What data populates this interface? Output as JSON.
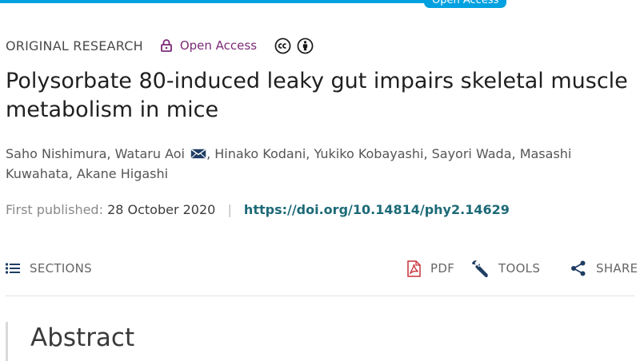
{
  "header": {
    "open_access_tab": "Open Access"
  },
  "article": {
    "type": "ORIGINAL RESEARCH",
    "open_access_label": "Open Access",
    "title": "Polysorbate 80-induced leaky gut impairs skeletal muscle metabolism in mice",
    "authors": [
      "Saho Nishimura",
      "Wataru Aoi",
      "Hinako Kodani",
      "Yukiko Kobayashi",
      "Sayori Wada",
      "Masashi Kuwahata",
      "Akane Higashi"
    ],
    "author_separator": ", ",
    "corresponding_author_icon": "envelope-icon",
    "published_label": "First published:",
    "published_date": "28 October 2020",
    "pub_separator": "|",
    "doi": "https://doi.org/10.14814/phy2.14629"
  },
  "toolbar": {
    "sections_label": "SECTIONS",
    "pdf_label": "PDF",
    "tools_label": "TOOLS",
    "share_label": "SHARE"
  },
  "abstract": {
    "heading": "Abstract"
  },
  "colors": {
    "accent_blue": "#00a1e0",
    "open_access_purple": "#7b2a77",
    "doi_teal": "#1d6a77",
    "pdf_red": "#c8323a",
    "icon_navy": "#1f3d63"
  },
  "icons": {
    "license": [
      "cc-icon",
      "by-icon"
    ],
    "lock": "lock-icon",
    "sections": "list-icon",
    "pdf": "pdf-icon",
    "tools": "wrench-icon",
    "share": "share-icon"
  }
}
